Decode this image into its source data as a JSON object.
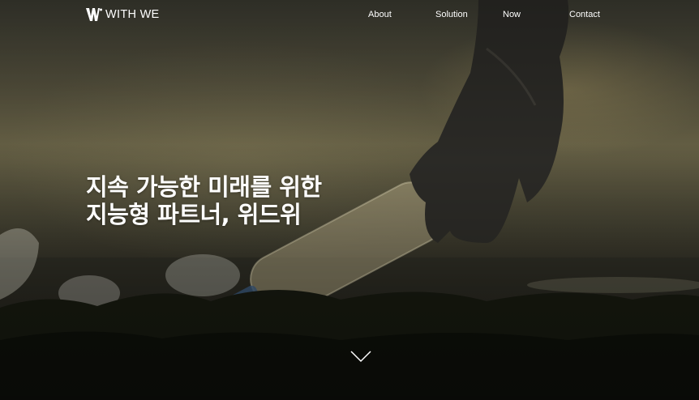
{
  "header": {
    "brand": "WITH WE",
    "nav": [
      {
        "label": "About"
      },
      {
        "label": "Solution"
      },
      {
        "label": "Now"
      },
      {
        "label": "Contact"
      }
    ]
  },
  "hero": {
    "headline_line1": "지속 가능한 미래를 위한",
    "headline_line2": "지능형 파트너, 위드위"
  },
  "icons": {
    "logo": "w-logo-mark",
    "scroll": "chevron-down-icon"
  },
  "colors": {
    "text": "#ffffff"
  }
}
